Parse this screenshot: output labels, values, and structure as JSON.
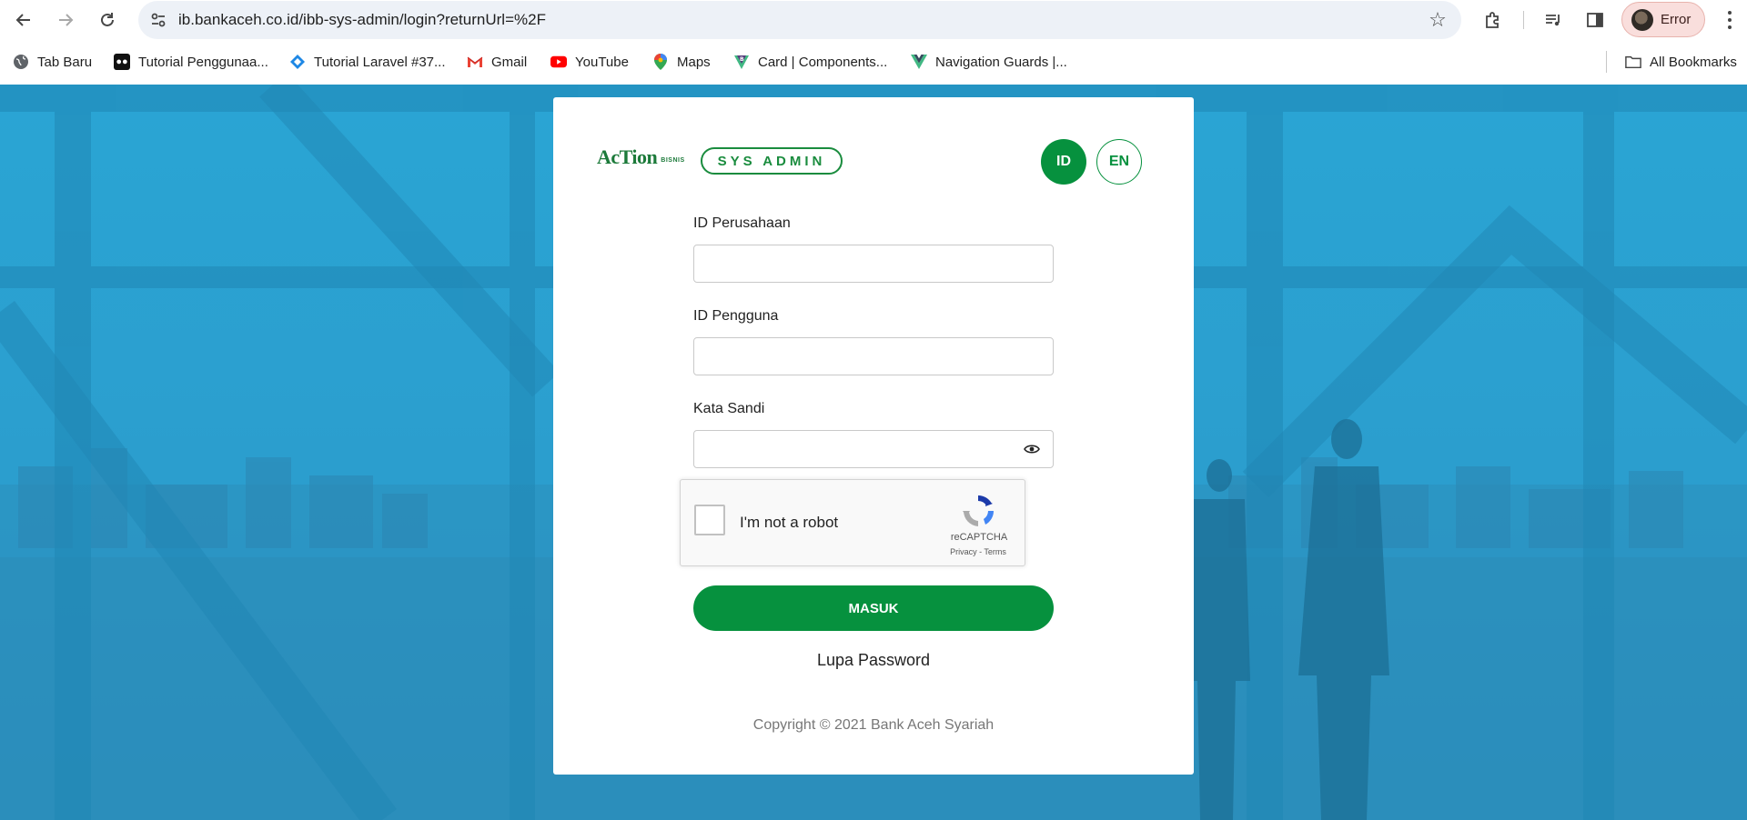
{
  "browser": {
    "url": "ib.bankaceh.co.id/ibb-sys-admin/login?returnUrl=%2F",
    "profile_status": "Error"
  },
  "bookmarks": [
    {
      "label": "Tab Baru",
      "icon": "globe-icon"
    },
    {
      "label": "Tutorial Penggunaa...",
      "icon": "site-favicon-icon"
    },
    {
      "label": "Tutorial Laravel #37...",
      "icon": "code-favicon-icon"
    },
    {
      "label": "Gmail",
      "icon": "gmail-icon"
    },
    {
      "label": "YouTube",
      "icon": "youtube-icon"
    },
    {
      "label": "Maps",
      "icon": "maps-pin-icon"
    },
    {
      "label": "Card | Components...",
      "icon": "bootstrap-vue-icon"
    },
    {
      "label": "Navigation Guards |...",
      "icon": "vue-icon"
    }
  ],
  "all_bookmarks_label": "All Bookmarks",
  "login": {
    "logo_text": "AcTion",
    "logo_sub": "BISNIS",
    "badge": "SYS ADMIN",
    "languages": [
      "ID",
      "EN"
    ],
    "active_language": "ID",
    "fields": [
      {
        "label": "ID Perusahaan",
        "value": ""
      },
      {
        "label": "ID Pengguna",
        "value": ""
      },
      {
        "label": "Kata Sandi",
        "value": ""
      }
    ],
    "recaptcha": {
      "label": "I'm not a robot",
      "brand": "reCAPTCHA",
      "links": "Privacy - Terms"
    },
    "submit_label": "MASUK",
    "forgot_label": "Lupa Password",
    "copyright": "Copyright © 2021 Bank Aceh Syariah"
  },
  "colors": {
    "brand_green": "#06913e",
    "background_blue": "#2aa5d4"
  }
}
